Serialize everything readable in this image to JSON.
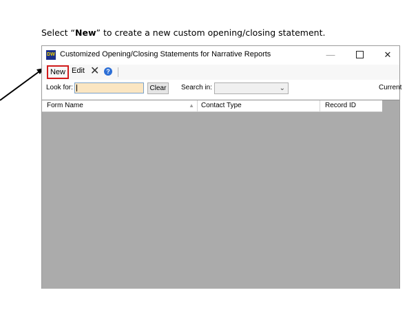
{
  "instruction": {
    "prefix": "Select “",
    "bold": "New",
    "suffix": "” to create a new custom opening/closing statement."
  },
  "window": {
    "app_icon_text": "DW",
    "title": "Customized Opening/Closing Statements for Narrative Reports",
    "minimize_glyph": "—",
    "close_glyph": "✕"
  },
  "toolbar": {
    "new_label": "New",
    "edit_label": "Edit",
    "delete_glyph": "✕",
    "help_glyph": "?"
  },
  "search": {
    "look_for_label": "Look for:",
    "look_for_value": "",
    "clear_label": "Clear",
    "search_in_label": "Search in:",
    "search_in_value": "",
    "current_label": "Current"
  },
  "grid": {
    "columns": [
      "Form Name",
      "Contact Type",
      "Record ID"
    ],
    "rows": []
  },
  "colors": {
    "highlight": "#d21a1a",
    "grid_background": "#ababab",
    "input_background": "#fbe6c2"
  }
}
